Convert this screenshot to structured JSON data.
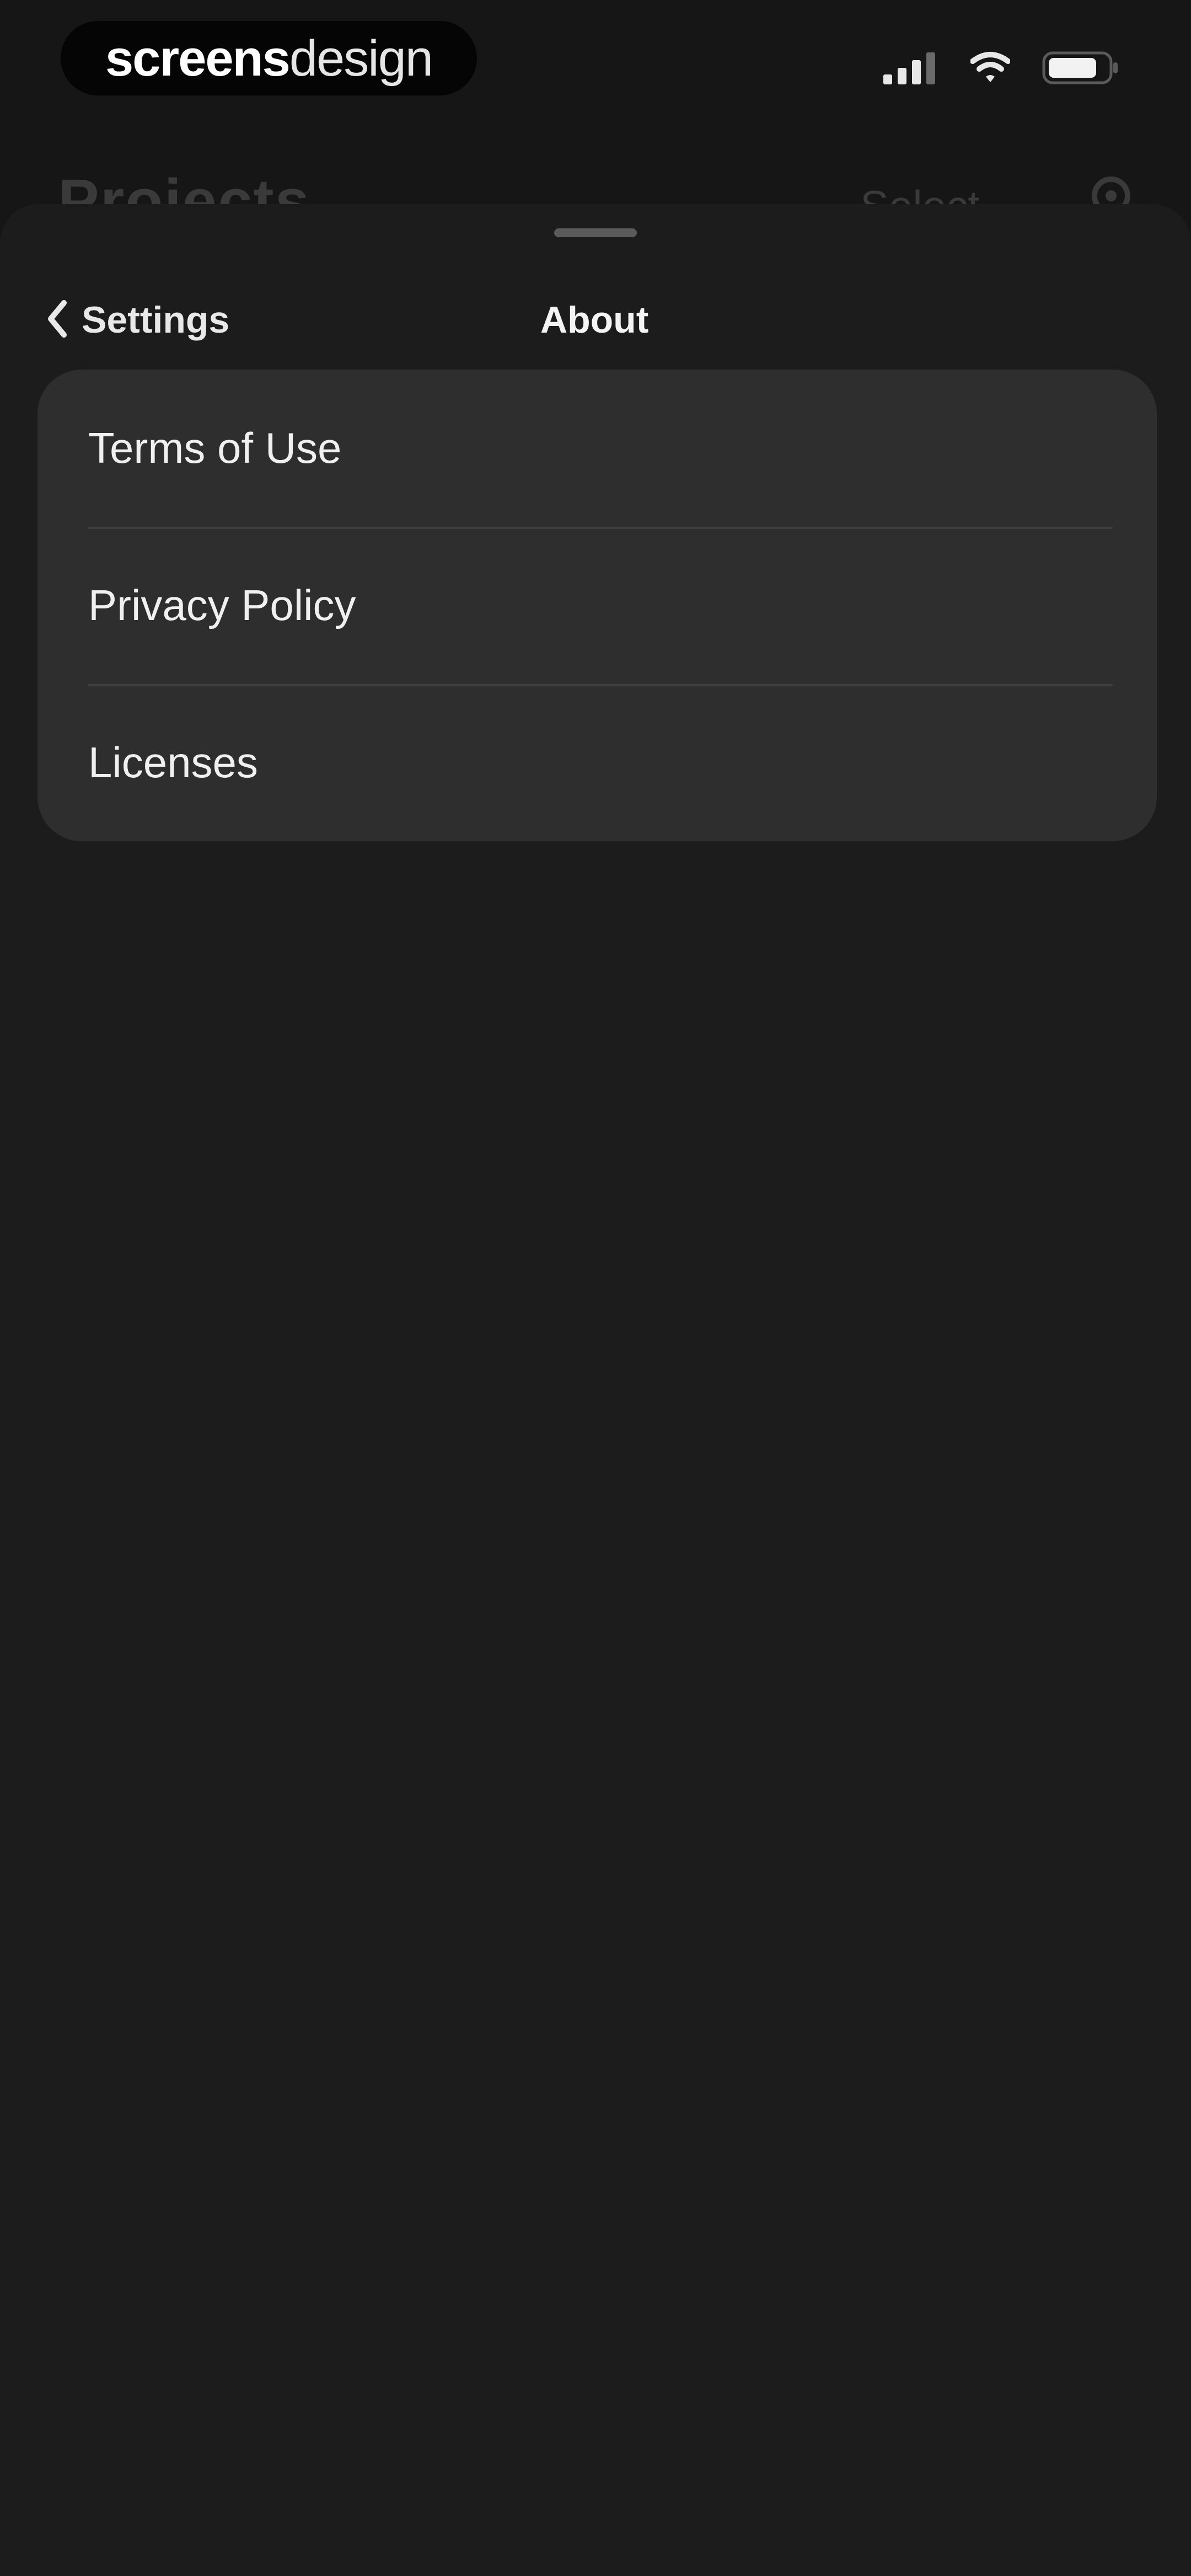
{
  "status_bar": {
    "brand_primary": "screens",
    "brand_secondary": "design",
    "icons": [
      "cellular-signal-icon",
      "wifi-icon",
      "battery-icon"
    ]
  },
  "background_page": {
    "title": "Projects",
    "select_label": "Select",
    "icon": "gear-icon"
  },
  "sheet": {
    "back_label": "Settings",
    "back_icon": "chevron-left-icon",
    "title": "About",
    "items": [
      {
        "label": "Terms of Use"
      },
      {
        "label": "Privacy Policy"
      },
      {
        "label": "Licenses"
      }
    ]
  },
  "colors": {
    "background": "#161616",
    "sheet": "#1c1c1c",
    "card": "#2e2e2e",
    "text": "#f0f0f0"
  }
}
